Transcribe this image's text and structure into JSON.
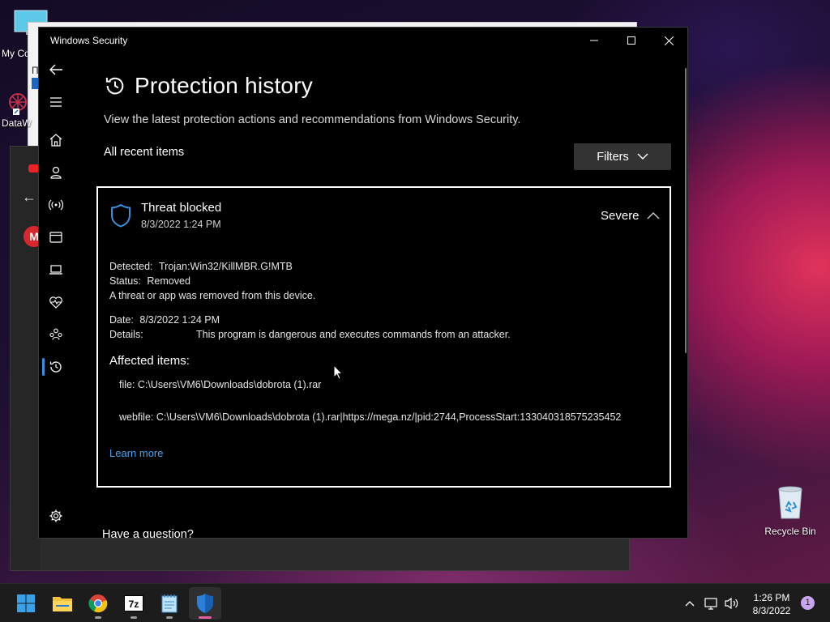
{
  "desktop": {
    "icons": [
      {
        "label": "My Co"
      },
      {
        "label": "DataW"
      }
    ],
    "recycle_bin": {
      "label": "Recycle Bin"
    }
  },
  "window": {
    "title": "Windows Security",
    "controls": {
      "minimize": "—",
      "maximize": "☐",
      "close": "✕"
    }
  },
  "page": {
    "title": "Protection history",
    "subtitle": "View the latest protection actions and recommendations from Windows Security.",
    "section_label": "All recent items",
    "filters_label": "Filters",
    "footer_heading": "Have a question?"
  },
  "threat_card": {
    "heading": "Threat blocked",
    "date": "8/3/2022 1:24 PM",
    "severity": "Severe",
    "detected_label": "Detected:",
    "detected_value": "Trojan:Win32/KillMBR.G!MTB",
    "status_label": "Status:",
    "status_value": "Removed",
    "status_message": "A threat or app was removed from this device.",
    "date_label": "Date:",
    "date_value": "8/3/2022 1:24 PM",
    "details_label": "Details:",
    "details_value": "This program is dangerous and executes commands from an attacker.",
    "affected_heading": "Affected items:",
    "affected_items": [
      "file: C:\\Users\\VM6\\Downloads\\dobrota (1).rar",
      "webfile: C:\\Users\\VM6\\Downloads\\dobrota (1).rar|https://mega.nz/|pid:2744,ProcessStart:133040318575235452"
    ],
    "learn_more": "Learn more"
  },
  "taskbar": {
    "apps": [
      {
        "name": "start",
        "icon": "windows-logo-icon"
      },
      {
        "name": "file-explorer",
        "icon": "folder-icon"
      },
      {
        "name": "chrome",
        "icon": "chrome-icon"
      },
      {
        "name": "7-zip",
        "icon": "7zip-icon",
        "text": "7z"
      },
      {
        "name": "notepad",
        "icon": "notepad-icon"
      },
      {
        "name": "windows-security",
        "icon": "shield-icon"
      }
    ],
    "time": "1:26 PM",
    "date": "8/3/2022",
    "notification_count": "1"
  },
  "colors": {
    "accent_blue": "#3b8ede",
    "link_blue": "#4aa3f0",
    "card_border": "#ffffff",
    "window_bg": "#000000",
    "filters_bg": "#333333"
  }
}
